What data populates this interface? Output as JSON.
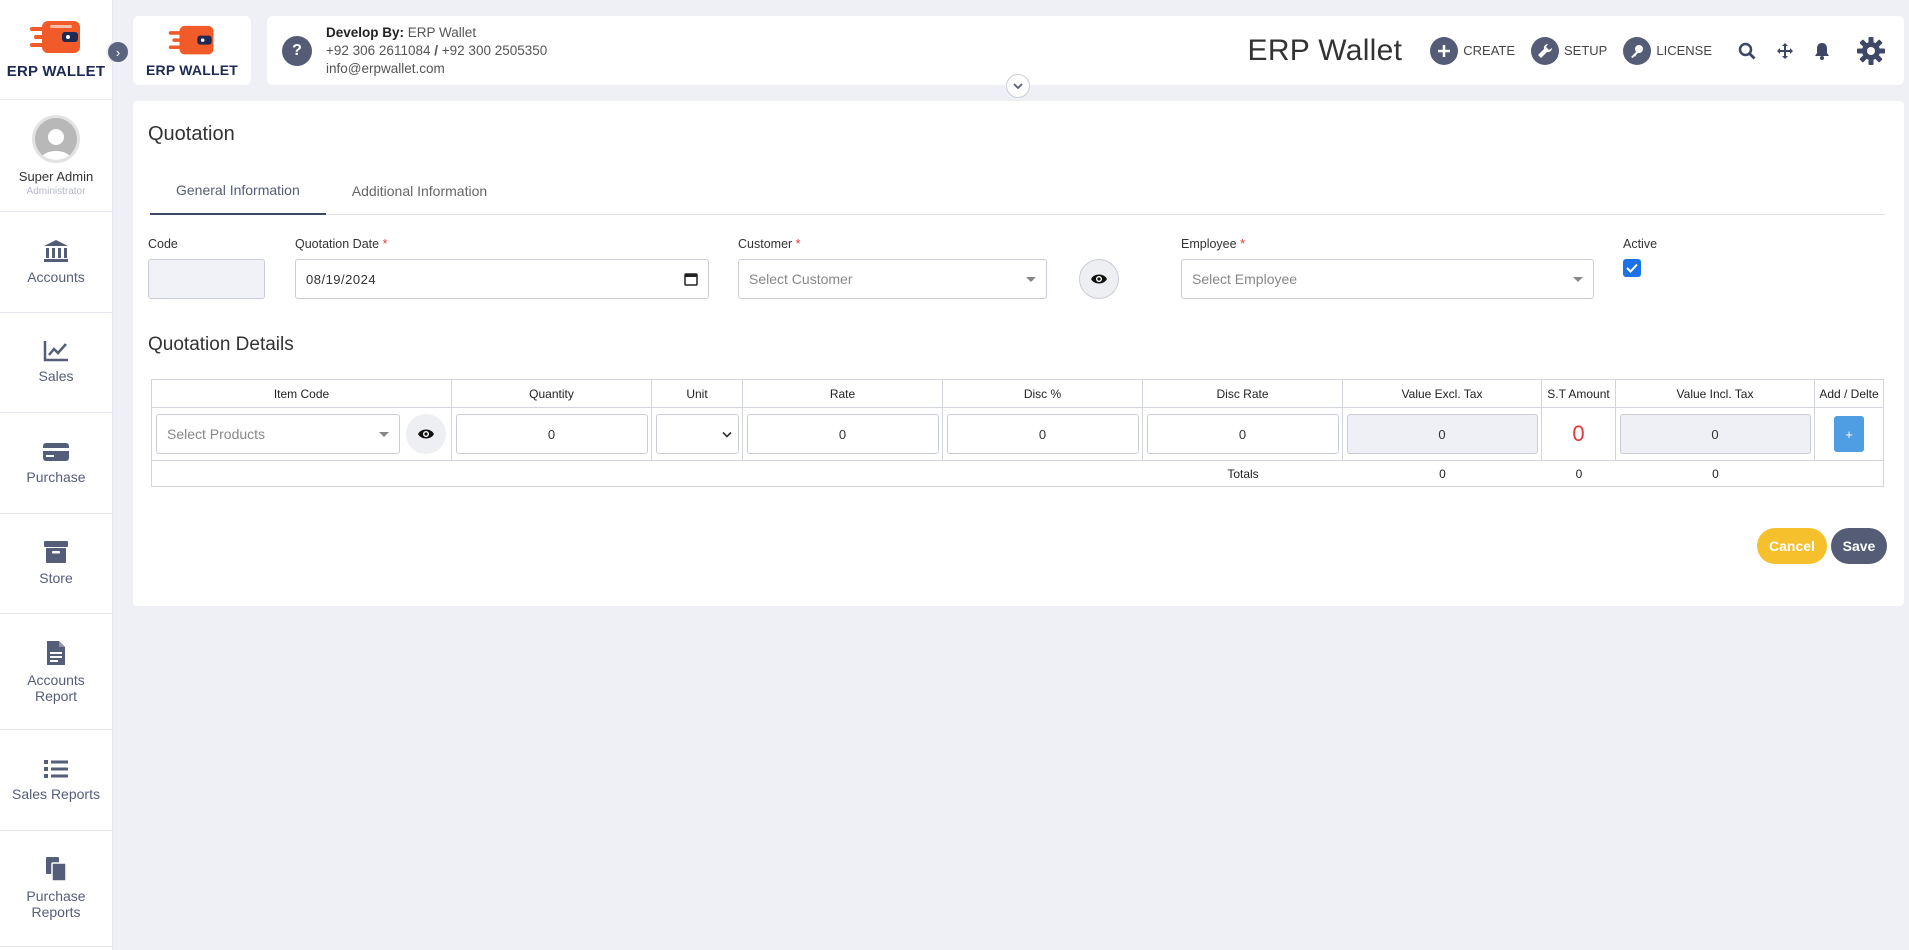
{
  "brand": {
    "name": "ERP WALLET"
  },
  "sidebar": {
    "profile": {
      "name": "Super Admin",
      "role": "Administrator"
    },
    "items": [
      {
        "label": "Accounts",
        "icon": "bank-icon"
      },
      {
        "label": "Sales",
        "icon": "chart-line-icon"
      },
      {
        "label": "Purchase",
        "icon": "credit-card-icon"
      },
      {
        "label": "Store",
        "icon": "archive-box-icon"
      },
      {
        "label": "Accounts Report",
        "icon": "document-icon"
      },
      {
        "label": "Sales Reports",
        "icon": "list-icon"
      },
      {
        "label": "Purchase Reports",
        "icon": "copy-icon"
      }
    ]
  },
  "header": {
    "dev_label": "Develop By:",
    "dev_name": "ERP Wallet",
    "phone1": "+92 306 2611084",
    "phone_sep": "/",
    "phone2": "+92 300 2505350",
    "email": "info@erpwallet.com",
    "app_title": "ERP Wallet",
    "create_label": "CREATE",
    "setup_label": "SETUP",
    "license_label": "LICENSE"
  },
  "page": {
    "title": "Quotation",
    "tabs": [
      "General Information",
      "Additional Information"
    ],
    "fields": {
      "code_label": "Code",
      "code_value": "",
      "date_label": "Quotation Date",
      "date_value": "08/19/2024",
      "customer_label": "Customer",
      "customer_placeholder": "Select Customer",
      "employee_label": "Employee",
      "employee_placeholder": "Select Employee",
      "active_label": "Active",
      "active_checked": true,
      "required_mark": "*"
    },
    "details_title": "Quotation Details",
    "table": {
      "headers": [
        "Item Code",
        "Quantity",
        "Unit",
        "Rate",
        "Disc %",
        "Disc Rate",
        "Value Excl. Tax",
        "S.T Amount",
        "Value Incl. Tax",
        "Add / Delte"
      ],
      "row": {
        "item_placeholder": "Select Products",
        "quantity": "0",
        "unit": "",
        "rate": "0",
        "disc_pct": "0",
        "disc_rate": "0",
        "value_excl": "0",
        "st_amount": "0",
        "value_incl": "0",
        "add_label": "+"
      },
      "totals": {
        "label": "Totals",
        "value_excl": "0",
        "st_amount": "0",
        "value_incl": "0"
      }
    },
    "buttons": {
      "cancel": "Cancel",
      "save": "Save"
    }
  },
  "colors": {
    "primary": "#545c76",
    "accent_orange": "#f15a29",
    "cancel": "#f6c02d",
    "add": "#4f9ee3",
    "danger": "#e03a3a"
  }
}
